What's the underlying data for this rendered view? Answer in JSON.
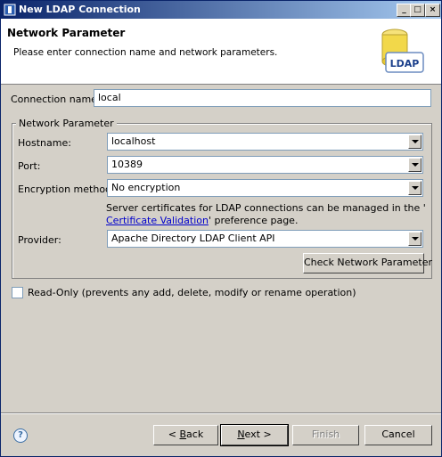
{
  "window": {
    "title": "New LDAP Connection",
    "controls": {
      "minimize": "_",
      "maximize": "□",
      "close": "×"
    }
  },
  "header": {
    "title": "Network Parameter",
    "description": "Please enter connection name and network parameters.",
    "logo_text": "LDAP"
  },
  "connection_name": {
    "label": "Connection name:",
    "value": "local"
  },
  "network_group": {
    "legend": "Network Parameter",
    "hostname": {
      "label": "Hostname:",
      "value": "localhost"
    },
    "port": {
      "label": "Port:",
      "value": "10389"
    },
    "encryption": {
      "label": "Encryption method:",
      "value": "No encryption"
    },
    "cert_note": {
      "line1": "Server certificates for LDAP connections can be managed in the '",
      "link": "Certificate Validation",
      "line2_suffix": "' preference page."
    },
    "provider": {
      "label": "Provider:",
      "value": "Apache Directory LDAP Client API"
    },
    "check_button": "Check Network Parameter"
  },
  "read_only": {
    "label": "Read-Only (prevents any add, delete, modify or rename operation)",
    "checked": false
  },
  "footer": {
    "help_icon": "?",
    "back": {
      "prefix": "< ",
      "mnemonic": "B",
      "rest": "ack"
    },
    "next": {
      "mnemonic": "N",
      "rest": "ext >"
    },
    "finish": "Finish",
    "cancel": "Cancel"
  }
}
